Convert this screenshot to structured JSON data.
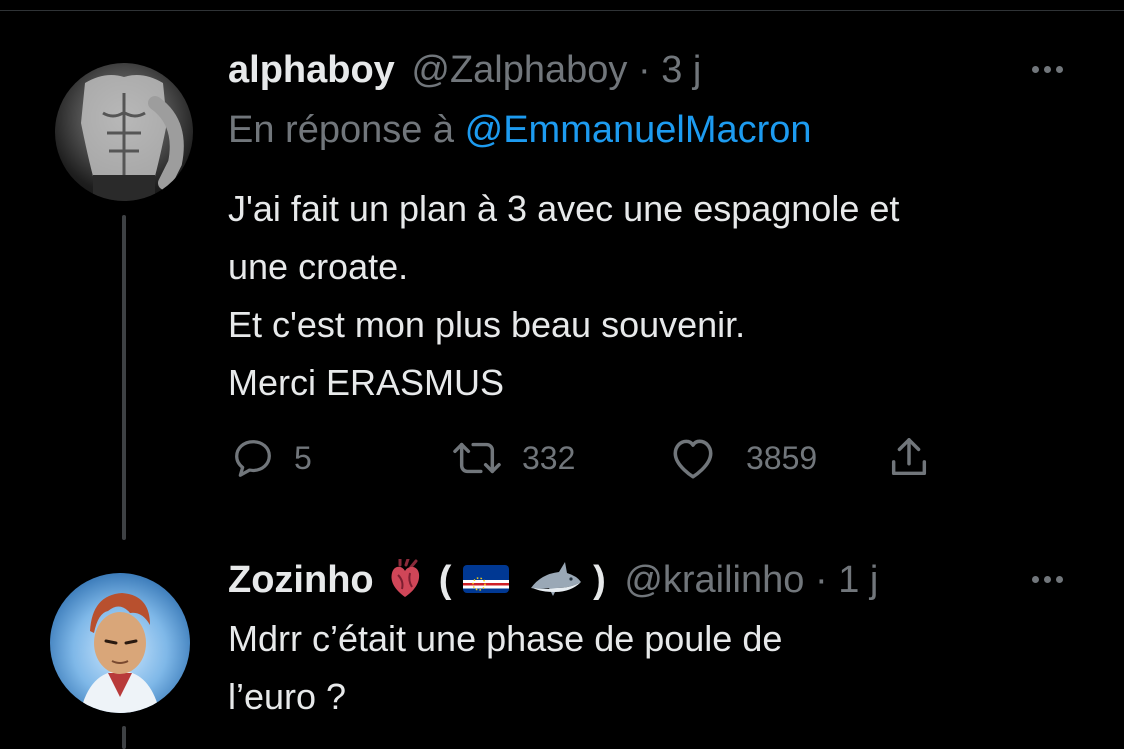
{
  "tweet1": {
    "display_name": "alphaboy",
    "handle": "@Zalphaboy",
    "sep": "·",
    "time": "3 j",
    "reply_prefix": "En réponse à",
    "reply_mention": "@EmmanuelMacron",
    "lines": [
      "J'ai fait un plan à 3 avec une espagnole et",
      "une croate.",
      "Et c'est mon plus beau souvenir.",
      "Merci ERASMUS"
    ],
    "replies": "5",
    "retweets": "332",
    "likes": "3859",
    "more_icon": "more-horizontal-icon"
  },
  "tweet2": {
    "display_name": "Zozinho",
    "name_paren_open": "(",
    "name_paren_close": ")",
    "handle": "@krailinho",
    "sep": "·",
    "time": "1 j",
    "lines": [
      "Mdrr c’était une phase de poule de",
      "l’euro ?"
    ],
    "emojis": [
      "anatomical-heart-emoji",
      "cape-verde-flag-emoji",
      "shark-emoji"
    ]
  },
  "colors": {
    "background": "#000000",
    "text": "#e7e9ea",
    "muted": "#71767b",
    "link": "#1d9bf0",
    "thread_line": "#3e4144"
  }
}
